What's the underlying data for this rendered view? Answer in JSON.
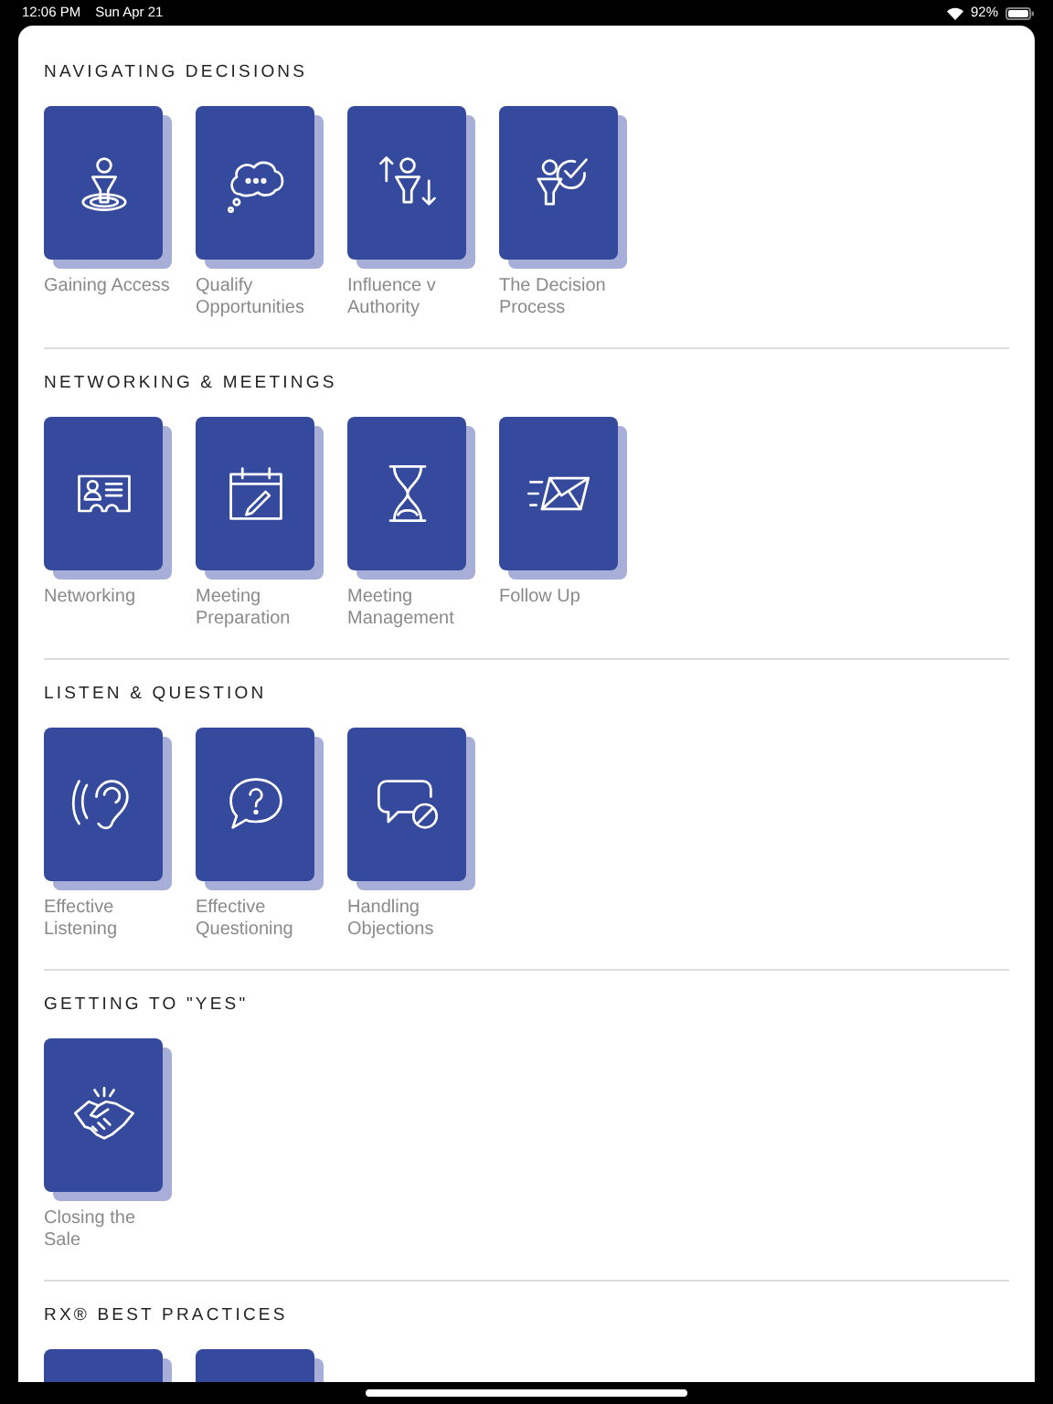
{
  "status_bar": {
    "time": "12:06 PM",
    "date": "Sun Apr 21",
    "battery": "92%"
  },
  "sections": [
    {
      "title": "NAVIGATING DECISIONS",
      "tiles": [
        {
          "kind": "access",
          "label": "Gaining Access"
        },
        {
          "kind": "thought",
          "label": "Qualify Opportunities"
        },
        {
          "kind": "influence",
          "label": "Influence v Authority"
        },
        {
          "kind": "decision",
          "label": "The Decision Process"
        }
      ]
    },
    {
      "title": "NETWORKING & MEETINGS",
      "tiles": [
        {
          "kind": "card",
          "label": "Networking"
        },
        {
          "kind": "calendar",
          "label": "Meeting Preparation"
        },
        {
          "kind": "hourglass",
          "label": "Meeting Management"
        },
        {
          "kind": "mail",
          "label": "Follow Up"
        }
      ]
    },
    {
      "title": "LISTEN & QUESTION",
      "tiles": [
        {
          "kind": "ear",
          "label": "Effective Listening"
        },
        {
          "kind": "question",
          "label": "Effective Questioning"
        },
        {
          "kind": "objection",
          "label": "Handling Objections"
        }
      ]
    },
    {
      "title": "GETTING TO \"YES\"",
      "tiles": [
        {
          "kind": "handshake",
          "label": "Closing the Sale"
        }
      ]
    },
    {
      "title": "RX® BEST PRACTICES",
      "tiles": [
        {
          "kind": "blank"
        },
        {
          "kind": "blank"
        }
      ]
    }
  ]
}
